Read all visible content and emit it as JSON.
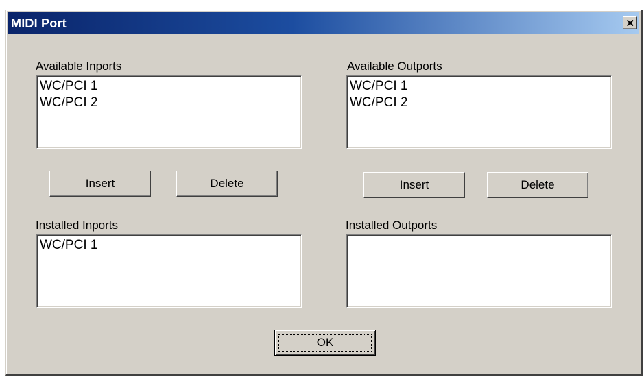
{
  "window": {
    "title": "MIDI Port"
  },
  "inports": {
    "available_label": "Available Inports",
    "available_items": [
      "WC/PCI 1",
      "WC/PCI 2"
    ],
    "installed_label": "Installed Inports",
    "installed_items": [
      "WC/PCI 1"
    ],
    "insert_label": "Insert",
    "delete_label": "Delete"
  },
  "outports": {
    "available_label": "Available Outports",
    "available_items": [
      "WC/PCI 1",
      "WC/PCI 2"
    ],
    "installed_label": "Installed Outports",
    "installed_items": [],
    "insert_label": "Insert",
    "delete_label": "Delete"
  },
  "footer": {
    "ok_label": "OK"
  },
  "icons": {
    "close": "close-icon"
  },
  "colors": {
    "title_gradient_start": "#0a246a",
    "title_gradient_end": "#a6caf0",
    "dialog_face": "#d4d0c8"
  }
}
